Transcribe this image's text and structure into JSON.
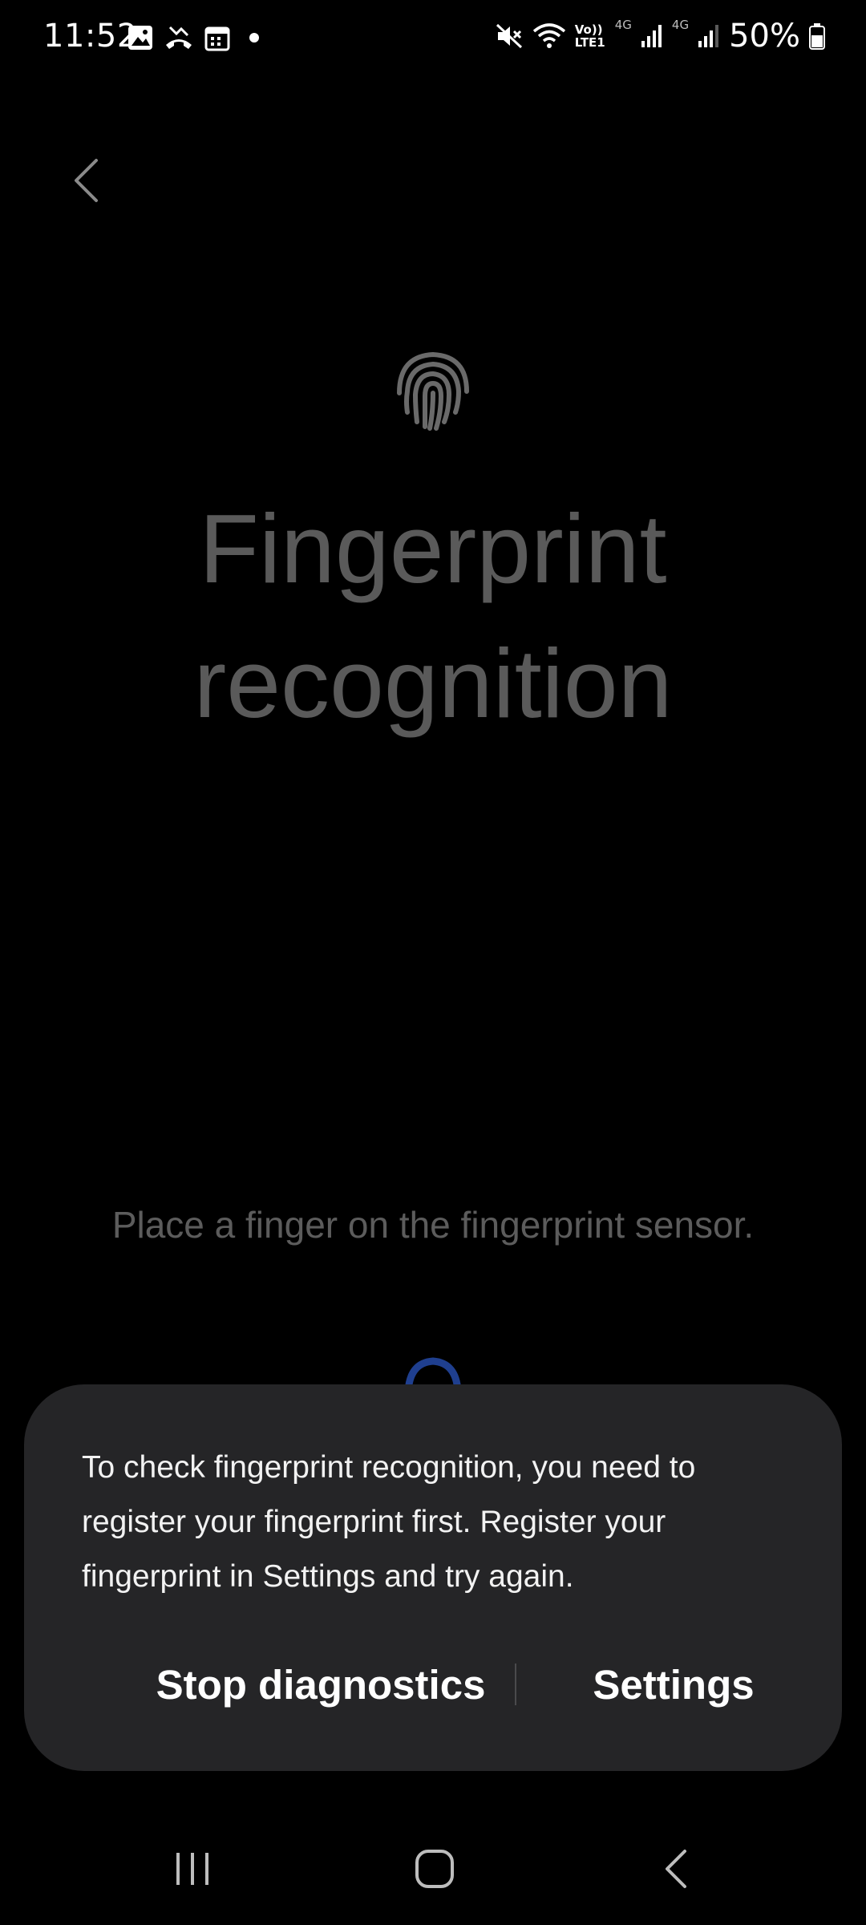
{
  "status_bar": {
    "time": "11:52",
    "left_icons": [
      "gallery-icon",
      "missed-call-icon",
      "calendar-icon",
      "dot-icon"
    ],
    "right_icons": [
      "mute-icon",
      "wifi-icon",
      "volte-icon",
      "signal-4g-icon",
      "signal-4g-icon",
      "battery-icon"
    ],
    "volte_label": "Vo)) LTE1",
    "network_label_1": "4G",
    "network_label_2": "4G",
    "battery_percent": "50%"
  },
  "header": {
    "back_icon": "chevron-left-icon"
  },
  "main": {
    "icon": "fingerprint-icon",
    "title_line1": "Fingerprint",
    "title_line2": "recognition",
    "instruction": "Place a finger on the fingerprint sensor."
  },
  "dialog": {
    "message": "To check fingerprint recognition, you need to register your fingerprint first. Register your fingerprint in Settings and try again.",
    "stop_button": "Stop diagnostics",
    "settings_button": "Settings"
  },
  "nav_bar": {
    "recents_icon": "recents-icon",
    "home_icon": "home-icon",
    "back_icon": "back-icon"
  },
  "colors": {
    "background": "#000000",
    "title": "#5a5a5a",
    "dialog_bg": "#252527",
    "spinner": "#1e3a8a"
  }
}
